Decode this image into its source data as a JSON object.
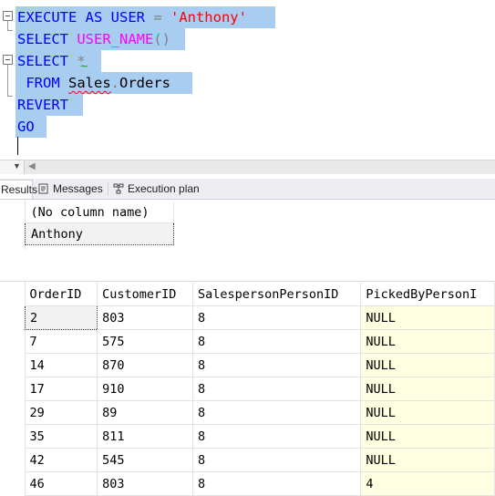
{
  "editor": {
    "lines": [
      {
        "parts": [
          {
            "t": "EXECUTE AS USER ",
            "c": "kw"
          },
          {
            "t": "= ",
            "c": "op"
          },
          {
            "t": "'Anthony'",
            "c": "str"
          }
        ]
      },
      {
        "parts": [
          {
            "t": "SELECT ",
            "c": "kw"
          },
          {
            "t": "USER_NAME",
            "c": "fn"
          },
          {
            "t": "()",
            "c": "op"
          }
        ]
      },
      {
        "parts": [
          {
            "t": "SELECT ",
            "c": "kw"
          },
          {
            "t": "*",
            "c": "op"
          }
        ]
      },
      {
        "parts": [
          {
            "t": " FROM ",
            "c": "kw"
          },
          {
            "t": "Sales",
            "c": "id squig"
          },
          {
            "t": ".",
            "c": "op"
          },
          {
            "t": "Orders",
            "c": "id"
          }
        ]
      },
      {
        "parts": [
          {
            "t": "REVERT",
            "c": "kw"
          }
        ]
      },
      {
        "parts": [
          {
            "t": "GO",
            "c": "kw"
          }
        ]
      }
    ]
  },
  "tabs": [
    {
      "label": "Results",
      "icon": "grid-icon",
      "active": true
    },
    {
      "label": "Messages",
      "icon": "messages-icon",
      "active": false
    },
    {
      "label": "Execution plan",
      "icon": "execution-plan-icon",
      "active": false
    }
  ],
  "grid1": {
    "columns": [
      "(No column name)"
    ],
    "rows": [
      [
        "Anthony"
      ]
    ]
  },
  "grid2": {
    "columns": [
      "OrderID",
      "CustomerID",
      "SalespersonPersonID",
      "PickedByPersonI"
    ],
    "rows": [
      [
        "2",
        "803",
        "8",
        "NULL"
      ],
      [
        "7",
        "575",
        "8",
        "NULL"
      ],
      [
        "14",
        "870",
        "8",
        "NULL"
      ],
      [
        "17",
        "910",
        "8",
        "NULL"
      ],
      [
        "29",
        "89",
        "8",
        "NULL"
      ],
      [
        "35",
        "811",
        "8",
        "NULL"
      ],
      [
        "42",
        "545",
        "8",
        "NULL"
      ],
      [
        "46",
        "803",
        "8",
        "4"
      ]
    ]
  }
}
